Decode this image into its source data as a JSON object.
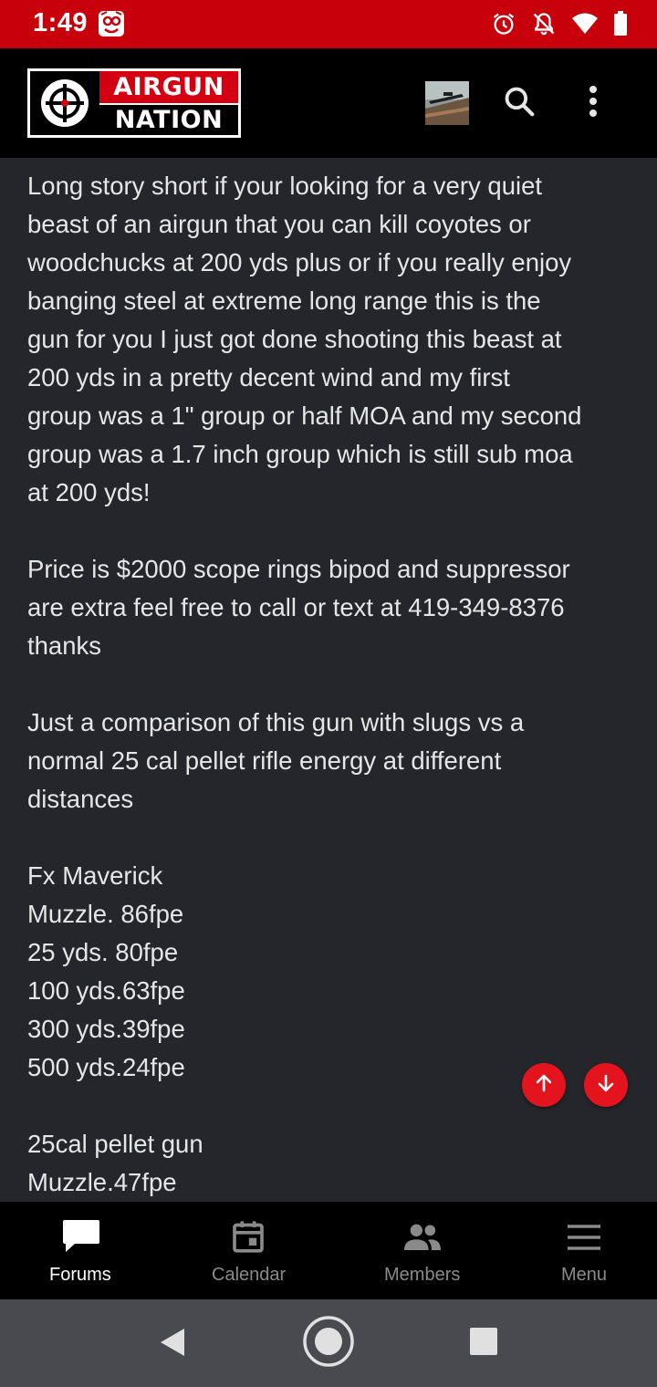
{
  "status_bar": {
    "time": "1:49",
    "icons": [
      "app-notification-icon",
      "alarm-icon",
      "notifications-off-icon",
      "wifi-icon",
      "battery-icon"
    ]
  },
  "header": {
    "logo_line1": "AIRGUN",
    "logo_line2": "NATION",
    "icons": [
      "crosshair-logo-icon",
      "search-icon",
      "more-vert-icon"
    ]
  },
  "post": {
    "paragraphs": [
      [
        "Long story short if your looking for a very quiet",
        "beast of an airgun that you can kill coyotes or",
        "woodchucks at 200 yds plus or if you really enjoy",
        "banging steel at extreme long range this is the",
        "gun for you I just got done shooting this beast at",
        "200 yds in a pretty decent wind and my first",
        "group was a 1\" group or half MOA and my second",
        "group was a 1.7 inch group which is still sub moa",
        "at 200 yds!"
      ],
      [
        "Price is $2000 scope rings bipod and suppressor",
        "are extra feel free to call or text at 419-349-8376",
        "thanks"
      ],
      [
        "Just a comparison of this gun with slugs vs a",
        "normal 25 cal pellet rifle energy at different",
        "distances"
      ],
      [
        "Fx Maverick",
        "Muzzle. 86fpe",
        "25 yds. 80fpe",
        "100 yds.63fpe",
        "300 yds.39fpe",
        "500 yds.24fpe"
      ],
      [
        "25cal pellet gun",
        "Muzzle.47fpe"
      ]
    ]
  },
  "scroll_buttons": {
    "up_icon": "arrow-up-icon",
    "down_icon": "arrow-down-icon",
    "color": "#e3141e"
  },
  "bottom_nav": {
    "items": [
      {
        "label": "Forums",
        "icon": "forums-icon",
        "active": true
      },
      {
        "label": "Calendar",
        "icon": "calendar-icon",
        "active": false
      },
      {
        "label": "Members",
        "icon": "members-icon",
        "active": false
      },
      {
        "label": "Menu",
        "icon": "menu-icon",
        "active": false
      }
    ]
  },
  "system_nav": {
    "icons": [
      "back-icon",
      "home-icon",
      "recents-icon"
    ]
  },
  "colors": {
    "status_bar": "#c7000b",
    "header": "#000000",
    "content_bg": "#25262b",
    "text": "#e6e6e6",
    "accent": "#e3141e"
  }
}
